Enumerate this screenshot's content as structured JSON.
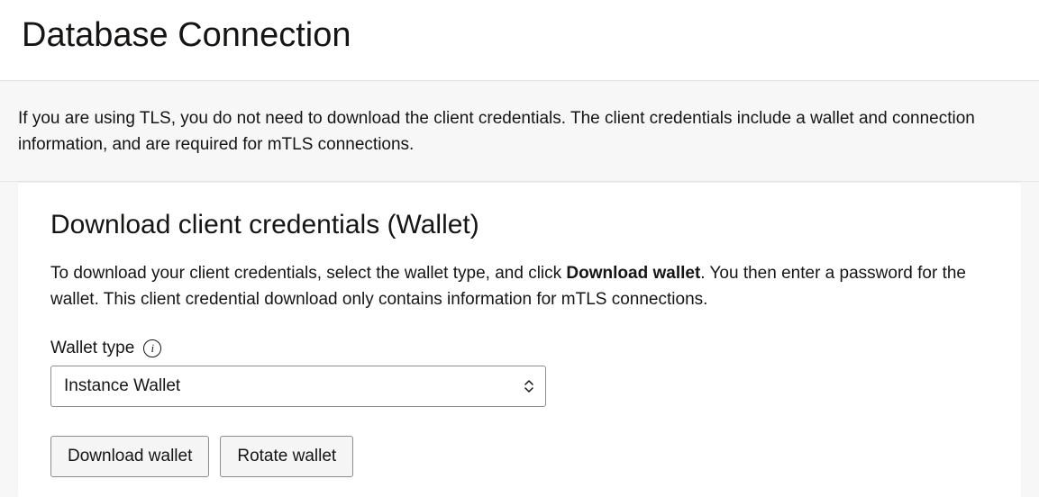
{
  "page": {
    "title": "Database Connection"
  },
  "info": {
    "text": "If you are using TLS, you do not need to download the client credentials. The client credentials include a wallet and connection information, and are required for mTLS connections."
  },
  "card": {
    "title": "Download client credentials (Wallet)",
    "desc_pre": "To download your client credentials, select the wallet type, and click ",
    "desc_bold": "Download wallet",
    "desc_post": ". You then enter a password for the wallet. This client credential download only contains information for mTLS connections.",
    "wallet_type_label": "Wallet type",
    "info_icon_glyph": "i",
    "wallet_type_value": "Instance Wallet",
    "download_btn": "Download wallet",
    "rotate_btn": "Rotate wallet"
  }
}
